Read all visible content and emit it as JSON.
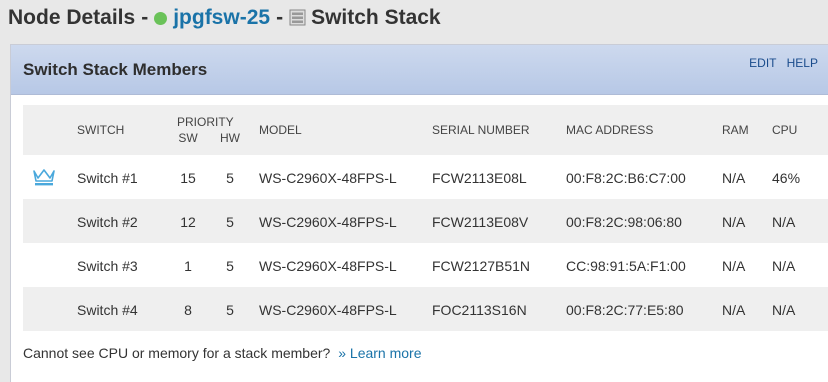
{
  "header": {
    "prefix": "Node Details",
    "separator": "-",
    "node_name": "jpgfsw-25",
    "node_status_color": "#6ac259",
    "node_status_icon": "status-up-dot",
    "view_icon": "switch-stack-icon",
    "view_title": "Switch Stack"
  },
  "panel": {
    "title": "Switch Stack Members",
    "edit_label": "EDIT",
    "help_label": "HELP"
  },
  "table": {
    "headers": {
      "switch": "SWITCH",
      "priority": "PRIORITY",
      "sw": "SW",
      "hw": "HW",
      "model": "MODEL",
      "serial": "SERIAL NUMBER",
      "mac": "MAC ADDRESS",
      "ram": "RAM",
      "cpu": "CPU"
    },
    "master_icon": "crown-icon",
    "rows": [
      {
        "switch": "Switch #1",
        "sw": "15",
        "hw": "5",
        "model": "WS-C2960X-48FPS-L",
        "serial": "FCW2113E08L",
        "mac": "00:F8:2C:B6:C7:00",
        "ram": "N/A",
        "cpu": "46%"
      },
      {
        "switch": "Switch #2",
        "sw": "12",
        "hw": "5",
        "model": "WS-C2960X-48FPS-L",
        "serial": "FCW2113E08V",
        "mac": "00:F8:2C:98:06:80",
        "ram": "N/A",
        "cpu": "N/A"
      },
      {
        "switch": "Switch #3",
        "sw": "1",
        "hw": "5",
        "model": "WS-C2960X-48FPS-L",
        "serial": "FCW2127B51N",
        "mac": "CC:98:91:5A:F1:00",
        "ram": "N/A",
        "cpu": "N/A"
      },
      {
        "switch": "Switch #4",
        "sw": "8",
        "hw": "5",
        "model": "WS-C2960X-48FPS-L",
        "serial": "FOC2113S16N",
        "mac": "00:F8:2C:77:E5:80",
        "ram": "N/A",
        "cpu": "N/A"
      }
    ]
  },
  "footer": {
    "note": "Cannot see CPU or memory for a stack member?",
    "link": "» Learn more"
  }
}
